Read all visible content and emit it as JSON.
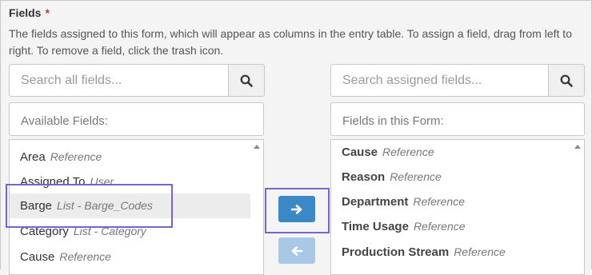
{
  "field": {
    "title": "Fields",
    "required_mark": "*",
    "description": "The fields assigned to this form, which will appear as columns in the entry table. To assign a field, drag from left to right. To remove a field, click the trash icon."
  },
  "available": {
    "search_placeholder": "Search all fields...",
    "header": "Available Fields:",
    "items": [
      {
        "name": "Area",
        "type": "Reference"
      },
      {
        "name": "Assigned To",
        "type": "User"
      },
      {
        "name": "Barge",
        "type": "List - Barge_Codes"
      },
      {
        "name": "Category",
        "type": "List - Category"
      },
      {
        "name": "Cause",
        "type": "Reference"
      }
    ]
  },
  "assigned": {
    "search_placeholder": "Search assigned fields...",
    "header": "Fields in this Form:",
    "items": [
      {
        "name": "Cause",
        "type": "Reference"
      },
      {
        "name": "Reason",
        "type": "Reference"
      },
      {
        "name": "Department",
        "type": "Reference"
      },
      {
        "name": "Time Usage",
        "type": "Reference"
      },
      {
        "name": "Production Stream",
        "type": "Reference"
      }
    ]
  },
  "icons": {
    "search": "search-icon",
    "move_right": "arrow-right-icon",
    "move_left": "arrow-left-icon",
    "scroll_up": "scroll-up-icon"
  },
  "colors": {
    "primary_button": "#3c87c6",
    "disabled_button": "#a9c8e6",
    "highlight": "#7b62c8",
    "required": "#d9302c"
  }
}
